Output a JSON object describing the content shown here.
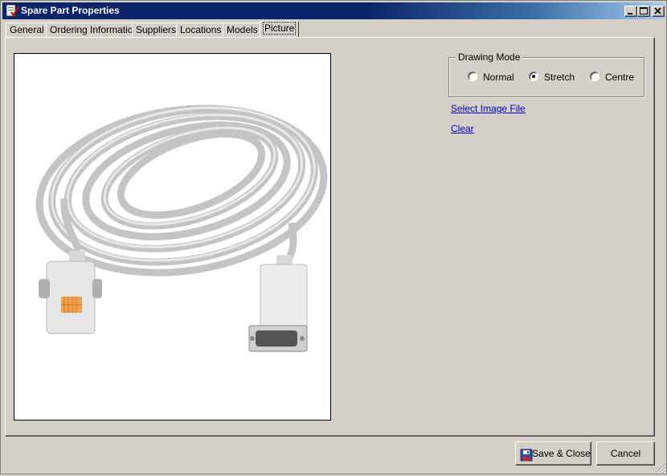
{
  "window": {
    "title": "Spare Part Properties",
    "icon": "app-icon",
    "controls": [
      "minimize-icon",
      "maximize-icon",
      "close-icon"
    ]
  },
  "tabs": [
    {
      "label": "General",
      "active": false
    },
    {
      "label": "Ordering Information",
      "active": false
    },
    {
      "label": "Suppliers",
      "active": false
    },
    {
      "label": "Locations",
      "active": false
    },
    {
      "label": "Models",
      "active": false
    },
    {
      "label": "Picture",
      "active": true
    }
  ],
  "picture": {
    "content": "grey-cable-photo"
  },
  "drawing_mode": {
    "legend": "Drawing Mode",
    "options": [
      {
        "label": "Normal",
        "selected": false
      },
      {
        "label": "Stretch",
        "selected": true
      },
      {
        "label": "Centre",
        "selected": false
      }
    ]
  },
  "links": {
    "select_image": "Select Image File",
    "clear": "Clear"
  },
  "buttons": {
    "save_close": "Save & Close",
    "save_icon": "floppy-disk-icon",
    "cancel": "Cancel"
  },
  "colors": {
    "titlebar": "#0a246a",
    "face": "#d4d0c8",
    "link": "#0000cc"
  }
}
